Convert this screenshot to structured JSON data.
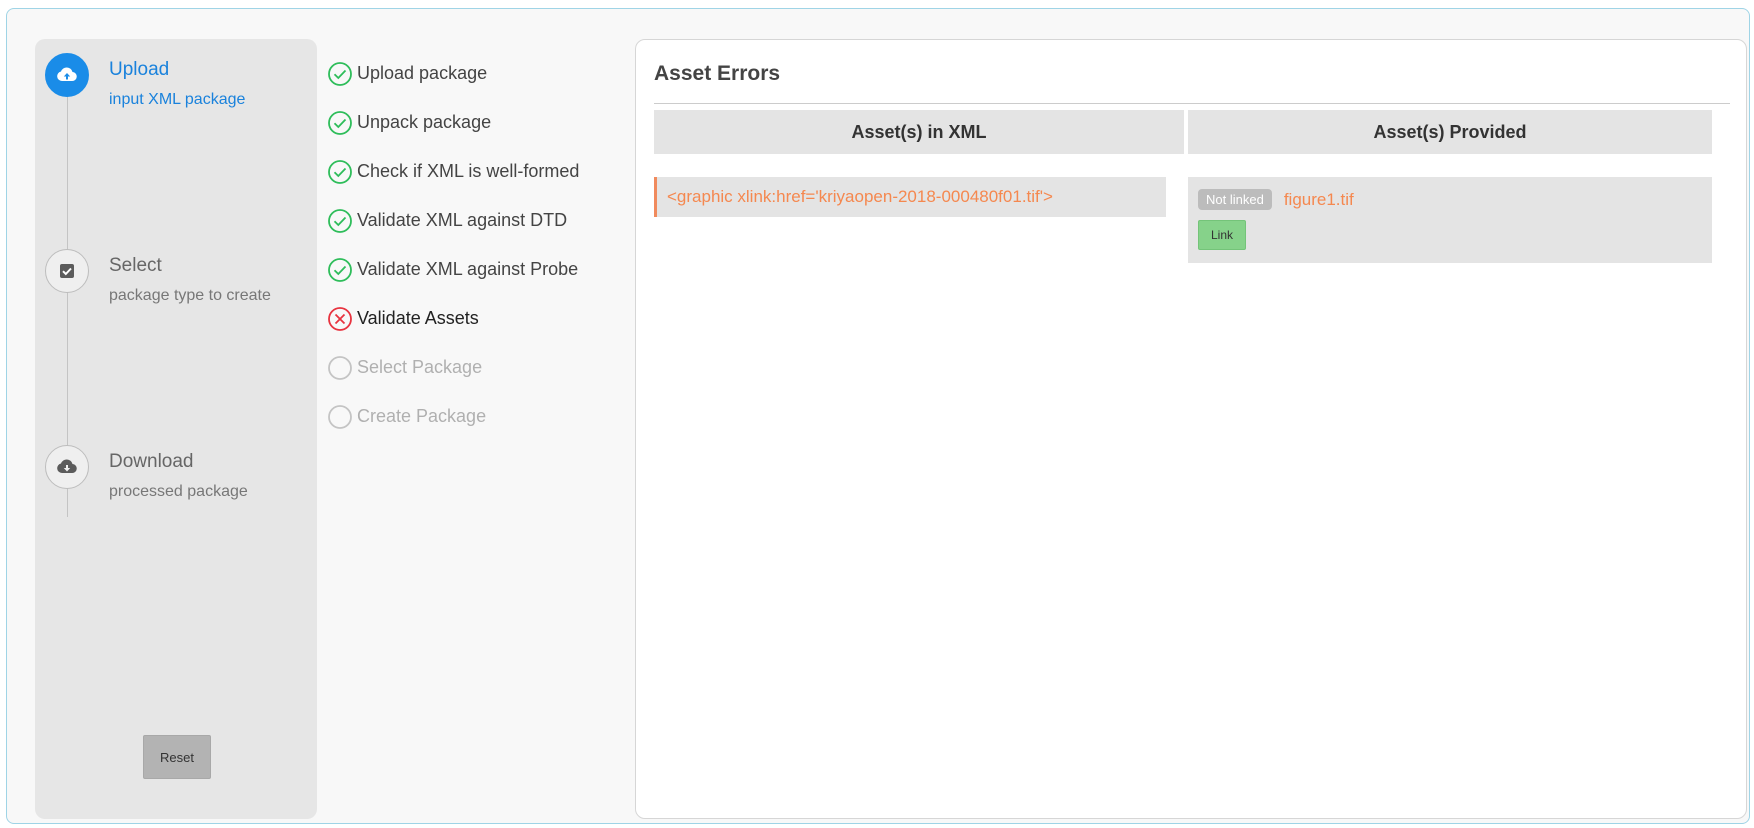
{
  "stepper": {
    "steps": [
      {
        "title": "Upload",
        "subtitle": "input XML package",
        "icon": "cloud-upload-icon",
        "state": "active"
      },
      {
        "title": "Select",
        "subtitle": "package type to create",
        "icon": "checkbox-icon",
        "state": "inactive"
      },
      {
        "title": "Download",
        "subtitle": "processed package",
        "icon": "cloud-download-icon",
        "state": "inactive"
      }
    ],
    "reset_label": "Reset",
    "accent_color": "#1a8ce8"
  },
  "checklist": {
    "items": [
      {
        "label": "Upload package",
        "status": "done"
      },
      {
        "label": "Unpack package",
        "status": "done"
      },
      {
        "label": "Check if XML is well-formed",
        "status": "done"
      },
      {
        "label": "Validate XML against DTD",
        "status": "done"
      },
      {
        "label": "Validate XML against Probe",
        "status": "done"
      },
      {
        "label": "Validate Assets",
        "status": "error"
      },
      {
        "label": "Select Package",
        "status": "pending"
      },
      {
        "label": "Create Package",
        "status": "pending"
      }
    ],
    "colors": {
      "done": "#2ebd5a",
      "error": "#e8333f",
      "pending": "#c4c4c4"
    }
  },
  "asset_errors": {
    "title": "Asset Errors",
    "columns": [
      "Asset(s) in XML",
      "Asset(s) Provided"
    ],
    "rows": [
      {
        "xml_asset": "<graphic xlink:href='kriyaopen-2018-000480f01.tif'>",
        "status_badge": "Not linked",
        "provided_file": "figure1.tif",
        "action_label": "Link"
      }
    ],
    "error_color": "#f5884f"
  }
}
